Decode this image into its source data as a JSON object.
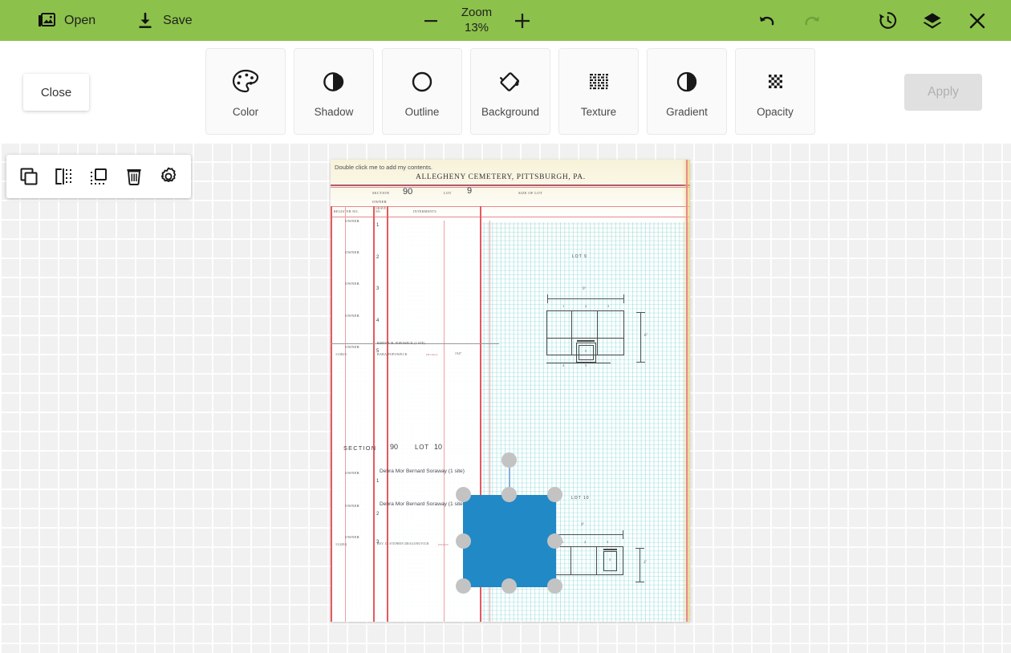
{
  "toolbar": {
    "open_label": "Open",
    "save_label": "Save",
    "zoom_title": "Zoom",
    "zoom_value": "13%",
    "minus_label": "−",
    "plus_label": "+",
    "bar_color": "#8cc24b",
    "icons": {
      "open": "open-image-icon",
      "save": "save-download-icon",
      "undo": "undo-arrow-icon",
      "redo": "redo-arrow-icon",
      "history": "history-clock-icon",
      "layers": "layers-icon",
      "close": "close-x-icon"
    }
  },
  "edit_panel": {
    "close_label": "Close",
    "apply_label": "Apply",
    "apply_enabled": false,
    "effects": [
      {
        "label": "Color",
        "icon": "palette-icon"
      },
      {
        "label": "Shadow",
        "icon": "shadow-moon-icon"
      },
      {
        "label": "Outline",
        "icon": "outline-circle-icon"
      },
      {
        "label": "Background",
        "icon": "paint-bucket-icon"
      },
      {
        "label": "Texture",
        "icon": "texture-weave-icon"
      },
      {
        "label": "Gradient",
        "icon": "gradient-half-circle-icon"
      },
      {
        "label": "Opacity",
        "icon": "opacity-checkerboard-icon"
      }
    ]
  },
  "object_toolbar": {
    "items": [
      {
        "icon": "duplicate-icon",
        "name": "duplicate-button"
      },
      {
        "icon": "flip-horizontal-icon",
        "name": "flip-button"
      },
      {
        "icon": "arrange-layer-icon",
        "name": "arrange-button"
      },
      {
        "icon": "trash-delete-icon",
        "name": "delete-button"
      },
      {
        "icon": "gear-settings-icon",
        "name": "settings-button"
      }
    ]
  },
  "selection": {
    "shape_color": "#2189c6",
    "handle_color": "#c3c3c3",
    "handle_count": 8,
    "has_rotation_handle": true
  },
  "document": {
    "placeholder": "Double click me to add my contents.",
    "title": "ALLEGHENY CEMETERY, PITTSBURGH, PA.",
    "header_fields": {
      "section_label": "SECTION",
      "section_value": "90",
      "lot_label": "LOT",
      "lot_value": "9",
      "size_label": "SIZE OF LOT",
      "owner_label": "OWNER"
    },
    "columns": {
      "register_no": "REGISTER NO.",
      "grave_no": "GRAVE NO.",
      "interments": "INTERMENTS"
    },
    "rows_lot9": [
      {
        "owner": "OWNER",
        "no": "1",
        "register": "",
        "name": ""
      },
      {
        "owner": "OWNER",
        "no": "2",
        "register": "",
        "name": ""
      },
      {
        "owner": "OWNER",
        "no": "3",
        "register": "",
        "name": ""
      },
      {
        "owner": "OWNER",
        "no": "4",
        "register": "",
        "name": ""
      },
      {
        "owner": "OWNER",
        "no": "5",
        "register": "133825",
        "name": "BABA POPOWECK",
        "note": "(Mother)",
        "date": "1947"
      }
    ],
    "row_annotation": "BERTHA M. POPOWECK    (1 STE)",
    "section2": {
      "section_label": "SECTION",
      "section_value": "90",
      "lot_label": "LOT",
      "lot_value": "10"
    },
    "rows_lot10": [
      {
        "owner": "OWNER",
        "no": "1",
        "name": "Debra Mor Bernard Soraway (1 site)"
      },
      {
        "owner": "OWNER",
        "no": "2",
        "name": "Debra Mor Bernard Soraway  (1 site)"
      },
      {
        "owner": "OWNER",
        "no": "3",
        "register": "133284",
        "name": "REV. D. STEPHEN DRAGONOVICH",
        "note": "INFANT",
        "date": "1941"
      }
    ],
    "diagram_lot9": {
      "label": "LOT 9",
      "width_dim": "9'",
      "height_dim": "6'",
      "top_plots": [
        "1",
        "2",
        "3"
      ],
      "bottom_plots": [
        "4",
        "5"
      ],
      "marker_plot": "5"
    },
    "diagram_lot10": {
      "label": "LOT 10",
      "width_dim": "9'",
      "height_dim": "3'",
      "top_plots": [
        "1",
        "2",
        "3"
      ],
      "marker_plot": "3"
    }
  }
}
